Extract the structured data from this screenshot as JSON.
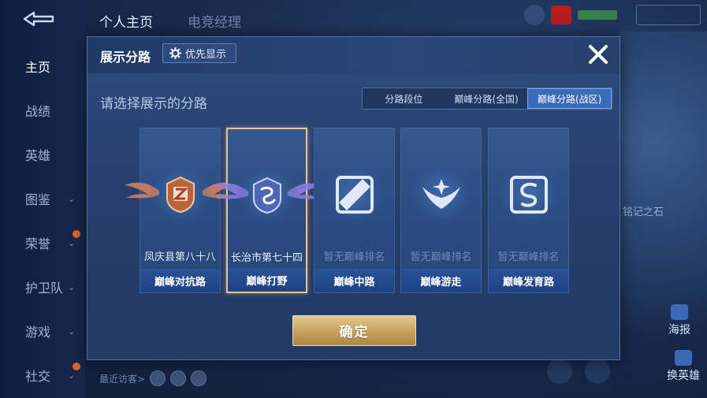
{
  "sidebar": {
    "items": [
      {
        "label": "主页",
        "active": true,
        "has_chevron": false,
        "has_dot": false
      },
      {
        "label": "战绩",
        "active": false,
        "has_chevron": false,
        "has_dot": false
      },
      {
        "label": "英雄",
        "active": false,
        "has_chevron": false,
        "has_dot": false
      },
      {
        "label": "图鉴",
        "active": false,
        "has_chevron": true,
        "has_dot": false
      },
      {
        "label": "荣誉",
        "active": false,
        "has_chevron": true,
        "has_dot": true
      },
      {
        "label": "护卫队",
        "active": false,
        "has_chevron": true,
        "has_dot": false
      },
      {
        "label": "游戏",
        "active": false,
        "has_chevron": true,
        "has_dot": false
      },
      {
        "label": "社交",
        "active": false,
        "has_chevron": true,
        "has_dot": true
      }
    ]
  },
  "top_tabs": [
    "个人主页",
    "电竞经理"
  ],
  "background": {
    "stone_label": "铭记之石",
    "poster_label": "海报",
    "change_hero_label": "换英雄",
    "recent_visitors_label": "最近访客>"
  },
  "modal": {
    "title": "展示分路",
    "priority_button": "优先显示",
    "subtitle": "请选择展示的分路",
    "tabs": [
      {
        "label": "分路段位",
        "active": false
      },
      {
        "label": "巅峰分路(全国)",
        "active": false
      },
      {
        "label": "巅峰分路(战区)",
        "active": true
      }
    ],
    "cards": [
      {
        "rank": "凤庆县第八十八",
        "lane": "巅峰对抗路",
        "has_rank": true,
        "selected": false,
        "emblem": "clash-lane-emblem"
      },
      {
        "rank": "长治市第七十四",
        "lane": "巅峰打野",
        "has_rank": true,
        "selected": true,
        "emblem": "jungle-emblem"
      },
      {
        "rank": "暂无巅峰排名",
        "lane": "巅峰中路",
        "has_rank": false,
        "selected": false,
        "emblem": "mid-lane-icon"
      },
      {
        "rank": "暂无巅峰排名",
        "lane": "巅峰游走",
        "has_rank": false,
        "selected": false,
        "emblem": "roam-icon"
      },
      {
        "rank": "暂无巅峰排名",
        "lane": "巅峰发育路",
        "has_rank": false,
        "selected": false,
        "emblem": "farm-lane-icon"
      }
    ],
    "confirm_button": "确定"
  },
  "colors": {
    "accent_gold": "#e7c48e",
    "tab_active": "#3a6ab8",
    "modal_bg": "#2d4b7d",
    "lane_bar": "#1f4384"
  }
}
